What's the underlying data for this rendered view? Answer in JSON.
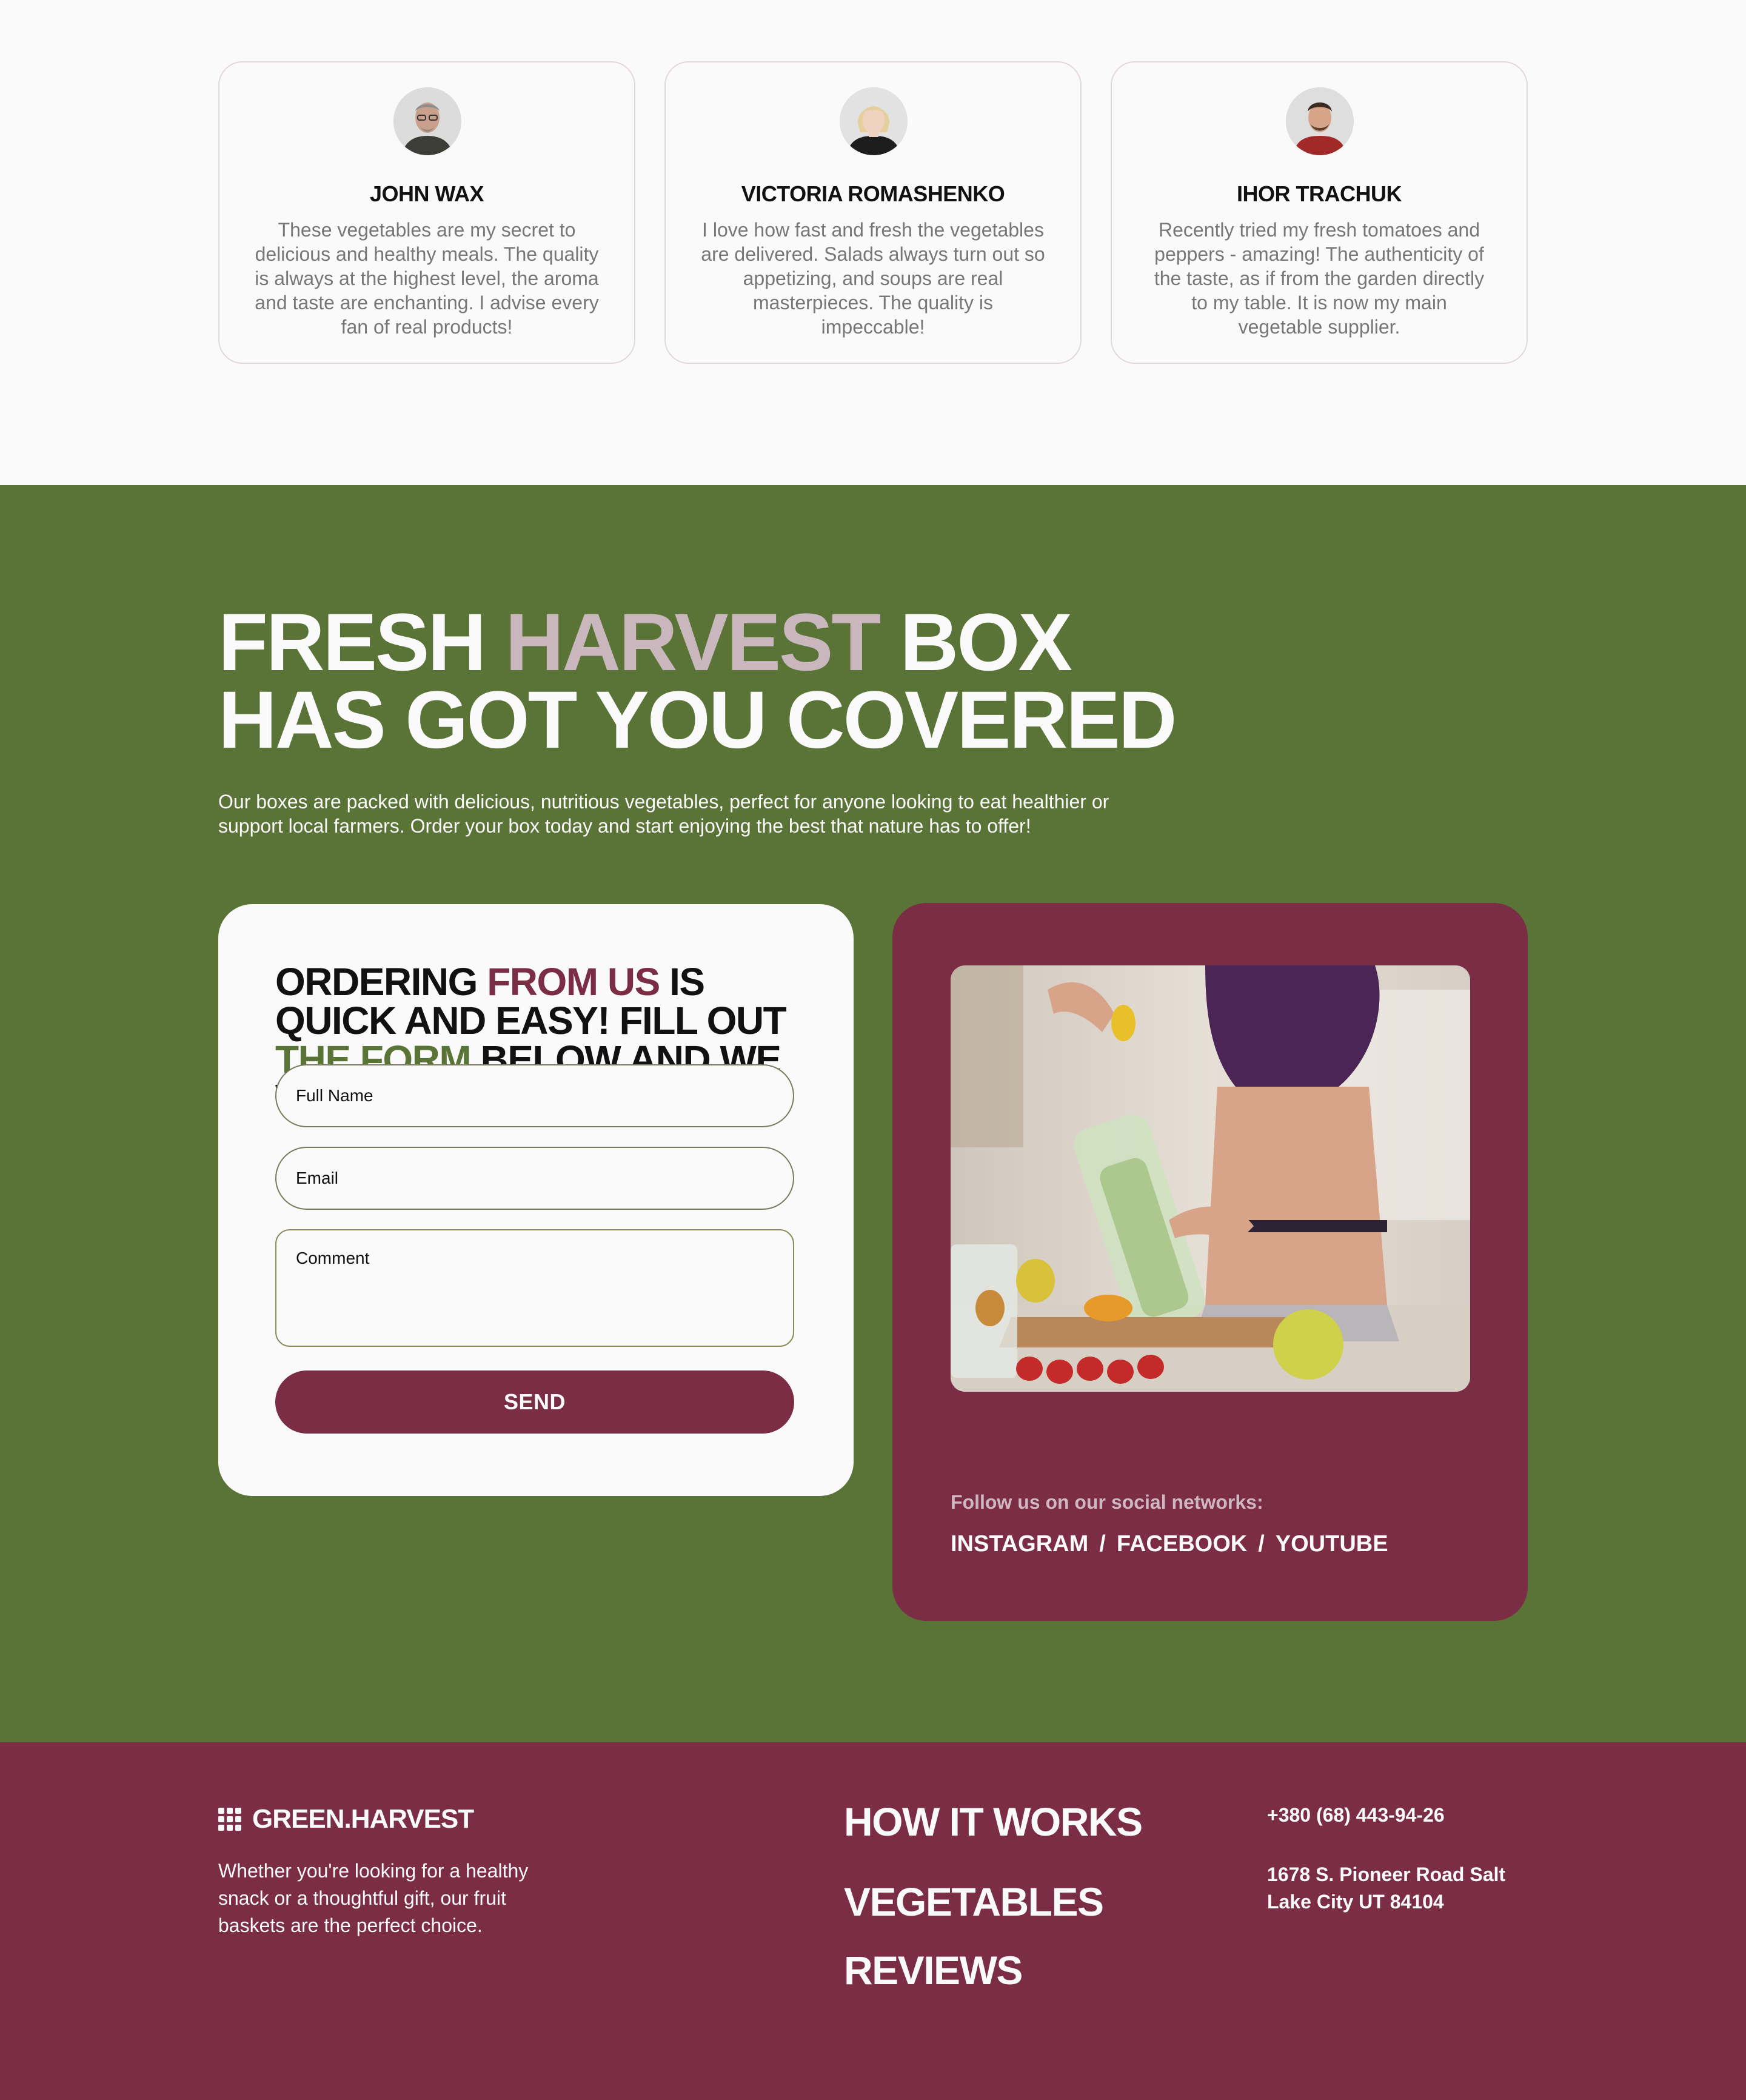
{
  "reviews": [
    {
      "name": "JOHN WAX",
      "text": "These vegetables are my secret to delicious and healthy meals. The quality is always at the highest level, the aroma and taste are enchanting. I advise every fan of real products!"
    },
    {
      "name": "VICTORIA ROMASHENKO",
      "text": "I love how fast and fresh the vegetables are delivered. Salads always turn out so appetizing, and soups are real masterpieces. The quality is impeccable!"
    },
    {
      "name": "IHOR TRACHUK",
      "text": "Recently tried my fresh tomatoes and peppers - amazing! The authenticity of the taste, as if from the garden directly to my table. It is now my main vegetable supplier."
    }
  ],
  "hero": {
    "title_part1": "FRESH ",
    "title_accent": "HARVEST",
    "title_part2": " BOX",
    "title_line2": "HAS GOT YOU COVERED",
    "intro": "Our boxes are packed with delicious, nutritious vegetables, perfect for anyone looking to eat healthier or support local farmers. Order your box today and start enjoying the best that nature has to offer!"
  },
  "form": {
    "title_1": "ORDERING ",
    "title_maroon": "FROM US",
    "title_2": " IS QUICK AND EASY! FILL OUT ",
    "title_green": "THE FORM",
    "title_3": " BELOW AND WE WILL CONTACT YOU !",
    "name_placeholder": "Full Name",
    "email_placeholder": "Email",
    "comment_placeholder": "Comment",
    "send_label": "SEND"
  },
  "social": {
    "follow_label": "Follow us on our social networks:",
    "links": [
      "INSTAGRAM",
      "FACEBOOK",
      "YOUTUBE"
    ],
    "separator": "/"
  },
  "footer": {
    "brand": "GREEN.HARVEST",
    "description": "Whether you're looking for a healthy snack or a thoughtful gift, our fruit baskets are the perfect choice.",
    "nav": [
      "HOW IT WORKS",
      "VEGETABLES",
      "REVIEWS"
    ],
    "phone": "+380 (68) 443-94-26",
    "address": "1678 S. Pioneer Road Salt Lake City UT 84104"
  },
  "colors": {
    "green": "#5a7337",
    "maroon": "#7a2d44",
    "accent_pink": "#c9b7bd",
    "background": "#fafafa"
  }
}
